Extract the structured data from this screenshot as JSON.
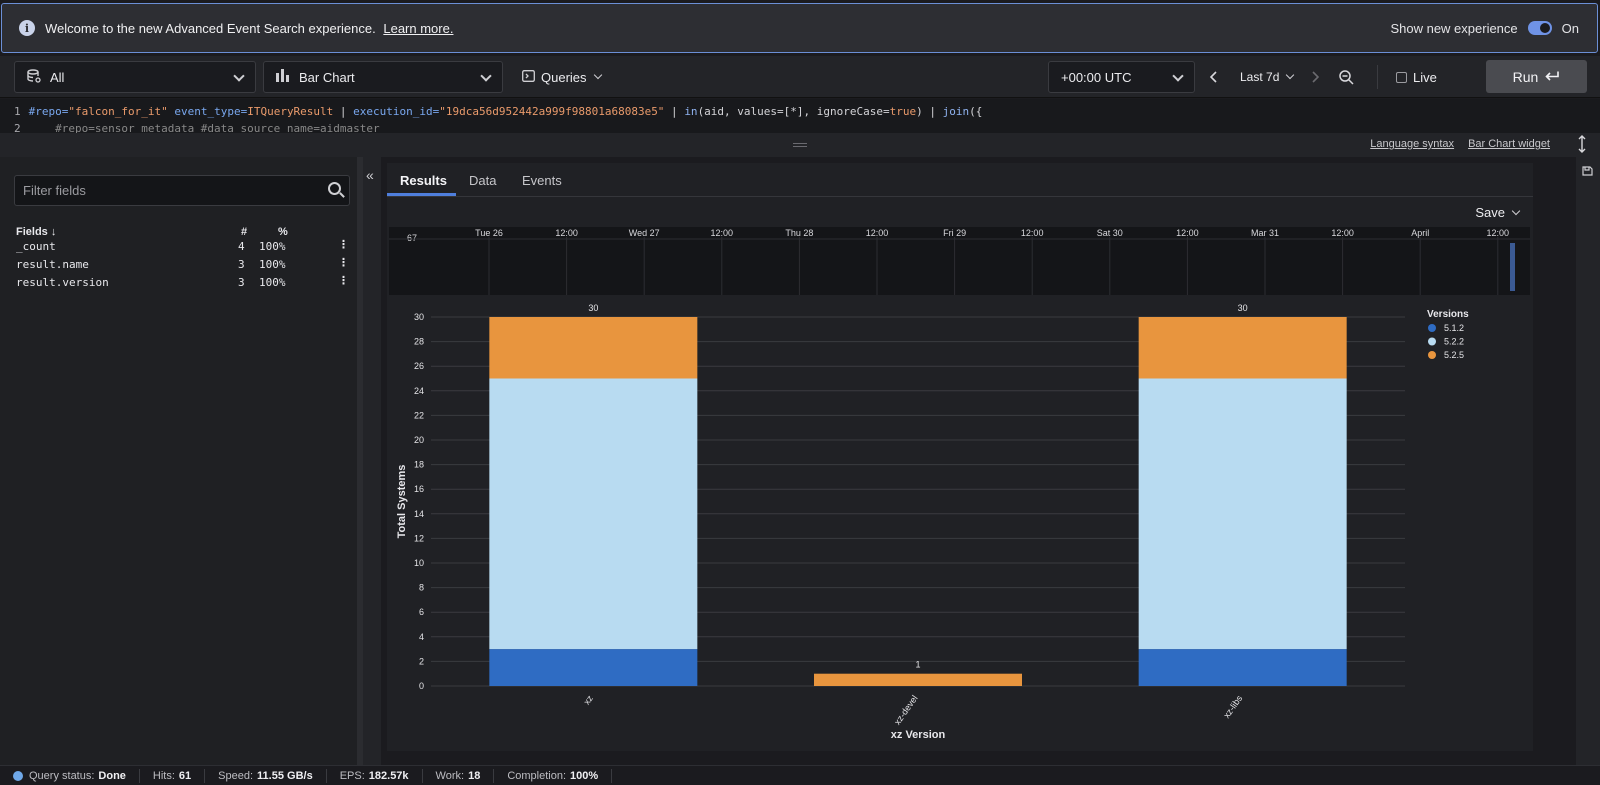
{
  "banner": {
    "message": "Welcome to the new Advanced Event Search experience.",
    "link": "Learn more.",
    "toggle_label": "Show new experience",
    "toggle_state": "On"
  },
  "toolbar": {
    "repo": "All",
    "widget": "Bar Chart",
    "queries": "Queries",
    "timezone": "+00:00 UTC",
    "timerange": "Last 7d",
    "live": "Live",
    "run": "Run"
  },
  "editor": {
    "line1_num": "1",
    "line1": [
      {
        "t": "#repo=",
        "c": "k"
      },
      {
        "t": "\"falcon_for_it\"",
        "c": "s"
      },
      {
        "t": " ",
        "c": "p"
      },
      {
        "t": "event_type=",
        "c": "k"
      },
      {
        "t": "ITQueryResult",
        "c": "s"
      },
      {
        "t": " | ",
        "c": "p"
      },
      {
        "t": "execution_id=",
        "c": "k"
      },
      {
        "t": "\"19dca56d952442a999f98801a68083e5\"",
        "c": "s"
      },
      {
        "t": " | ",
        "c": "p"
      },
      {
        "t": "in",
        "c": "f"
      },
      {
        "t": "(aid, values=[*], ignoreCase=",
        "c": "p"
      },
      {
        "t": "true",
        "c": "s"
      },
      {
        "t": ") | ",
        "c": "p"
      },
      {
        "t": "join",
        "c": "f"
      },
      {
        "t": "({",
        "c": "p"
      }
    ],
    "line2_num": "2",
    "line2": "    #repo=sensor_metadata #data_source_name=aidmaster"
  },
  "splitter": {
    "language_syntax": "Language syntax",
    "widget_link": "Bar Chart widget"
  },
  "fields_panel": {
    "filter_placeholder": "Filter fields",
    "header_fields": "Fields",
    "header_count": "#",
    "header_pct": "%",
    "fields": [
      {
        "name": "_count",
        "count": "4",
        "pct": "100%"
      },
      {
        "name": "result.name",
        "count": "3",
        "pct": "100%"
      },
      {
        "name": "result.version",
        "count": "3",
        "pct": "100%"
      }
    ]
  },
  "tabs": [
    "Results",
    "Data",
    "Events"
  ],
  "save_label": "Save",
  "timeline": {
    "y_max_label": "67",
    "ticks": [
      "Tue 26",
      "12:00",
      "Wed 27",
      "12:00",
      "Thu 28",
      "12:00",
      "Fri 29",
      "12:00",
      "Sat 30",
      "12:00",
      "Mar 31",
      "12:00",
      "April",
      "12:00"
    ]
  },
  "colors": {
    "v512": "#2f6cc3",
    "v522": "#b8dbf1",
    "v525": "#e8953e"
  },
  "chart_data": {
    "type": "bar",
    "stacked": true,
    "categories": [
      "xz",
      "xz-devel",
      "xz-libs"
    ],
    "series": [
      {
        "name": "5.1.2",
        "values": [
          3,
          0,
          3
        ]
      },
      {
        "name": "5.2.2",
        "values": [
          22,
          0,
          22
        ]
      },
      {
        "name": "5.2.5",
        "values": [
          5,
          1,
          5
        ]
      }
    ],
    "totals": [
      30,
      1,
      30
    ],
    "xlabel": "xz Version",
    "ylabel": "Total Systems",
    "ylim": [
      0,
      30
    ],
    "yticks": [
      0,
      2,
      4,
      6,
      8,
      10,
      12,
      14,
      16,
      18,
      20,
      22,
      24,
      26,
      28,
      30
    ],
    "legend_title": "Versions",
    "legend_position": "top-right",
    "grid": true
  },
  "status": {
    "query_status_label": "Query status:",
    "query_status": "Done",
    "hits_label": "Hits:",
    "hits": "61",
    "speed_label": "Speed:",
    "speed": "11.55 GB/s",
    "eps_label": "EPS:",
    "eps": "182.57k",
    "work_label": "Work:",
    "work": "18",
    "completion_label": "Completion:",
    "completion": "100%"
  }
}
